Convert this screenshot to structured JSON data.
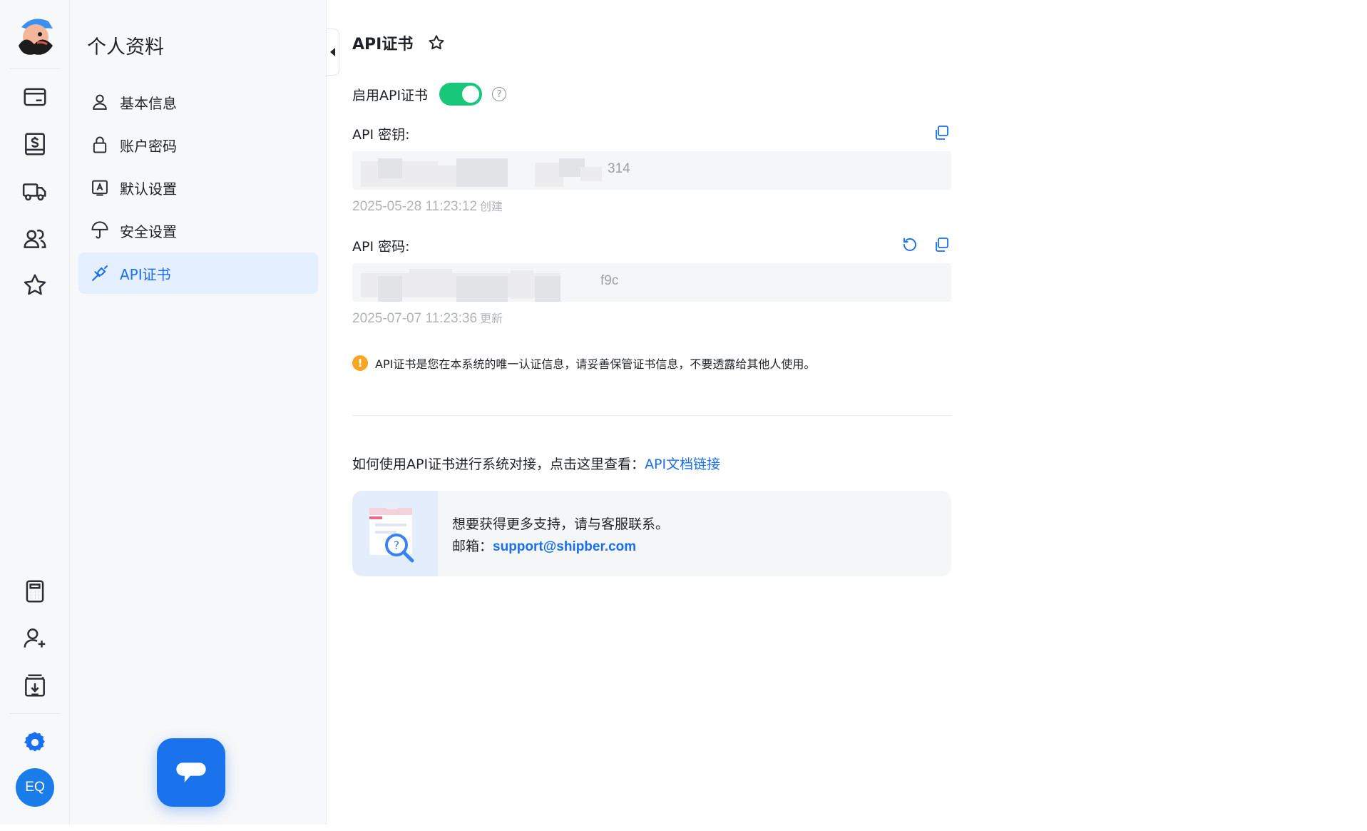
{
  "rail": {
    "avatar_initials": "EQ",
    "items": [
      "wallet-icon",
      "dollar-receipt-icon",
      "truck-icon",
      "users-icon",
      "star-icon",
      "calculator-icon",
      "add-user-icon",
      "download-box-icon",
      "gear-icon"
    ]
  },
  "sidebar": {
    "title": "个人资料",
    "items": [
      {
        "label": "基本信息",
        "icon": "user-icon"
      },
      {
        "label": "账户密码",
        "icon": "lock-icon"
      },
      {
        "label": "默认设置",
        "icon": "settings-a-icon"
      },
      {
        "label": "安全设置",
        "icon": "umbrella-icon"
      },
      {
        "label": "API证书",
        "icon": "plug-icon",
        "active": true
      }
    ]
  },
  "main": {
    "title": "API证书",
    "enable_label": "启用API证书",
    "enabled": true,
    "api_key": {
      "label": "API 密钥:",
      "value_suffix": "314",
      "created": "2025-05-28 11:23:12",
      "created_tag": "创建"
    },
    "api_secret": {
      "label": "API 密码:",
      "value_suffix": "f9c",
      "updated": "2025-07-07 11:23:36",
      "updated_tag": "更新"
    },
    "notice": "API证书是您在本系统的唯一认证信息，请妥善保管证书信息，不要透露给其他人使用。",
    "docs_prefix": "如何使用API证书进行系统对接，点击这里查看：",
    "docs_link": "API文档链接",
    "support_line": "想要获得更多支持，请与客服联系。",
    "email_label": "邮箱：",
    "email": "support@shipber.com"
  },
  "colors": {
    "accent": "#1a6ff0",
    "toggle_on": "#19c77b",
    "warning": "#f5a623"
  }
}
